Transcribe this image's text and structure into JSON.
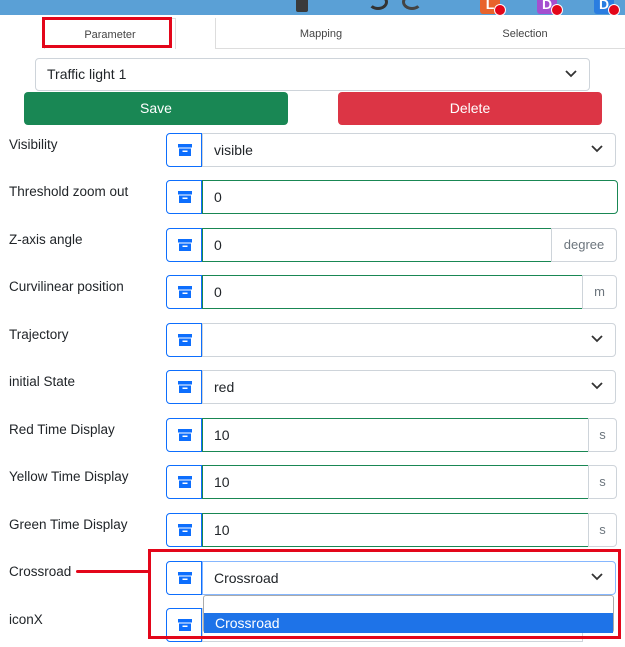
{
  "tabs": {
    "parameter": "Parameter",
    "mapping": "Mapping",
    "selection": "Selection"
  },
  "object_select": {
    "value": "Traffic light 1"
  },
  "buttons": {
    "save": "Save",
    "delete": "Delete"
  },
  "rows": [
    {
      "label": "Visibility",
      "type": "select",
      "value": "visible"
    },
    {
      "label": "Threshold zoom out",
      "type": "input",
      "value": "0"
    },
    {
      "label": "Z-axis angle",
      "type": "input",
      "value": "0",
      "unit": "degree"
    },
    {
      "label": "Curvilinear position",
      "type": "input",
      "value": "0",
      "unit": "m"
    },
    {
      "label": "Trajectory",
      "type": "select",
      "value": ""
    },
    {
      "label": "initial State",
      "type": "select",
      "value": "red"
    },
    {
      "label": "Red Time Display",
      "type": "input",
      "value": "10",
      "unit": "s"
    },
    {
      "label": "Yellow Time Display",
      "type": "input",
      "value": "10",
      "unit": "s"
    },
    {
      "label": "Green Time Display",
      "type": "input",
      "value": "10",
      "unit": "s"
    },
    {
      "label": "Crossroad",
      "type": "select",
      "value": "Crossroad"
    },
    {
      "label": "iconX",
      "type": "input",
      "value": ""
    }
  ],
  "crossroad_dropdown": {
    "options": [
      "",
      "Crossroad"
    ],
    "selected": "Crossroad"
  },
  "colors": {
    "save": "#198754",
    "delete": "#dc3545",
    "accent": "#0d6efd",
    "highlight": "#e3061a"
  }
}
